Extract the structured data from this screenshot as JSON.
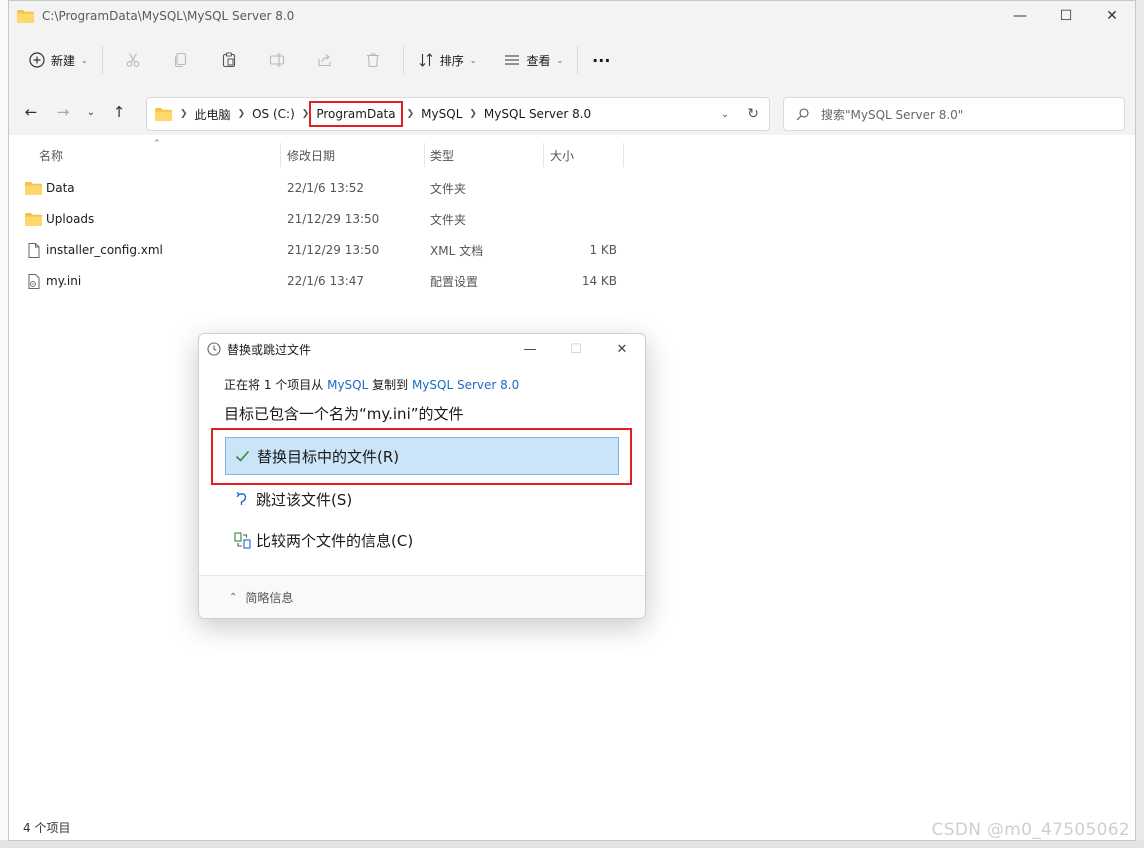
{
  "window": {
    "title": "C:\\ProgramData\\MySQL\\MySQL Server 8.0"
  },
  "toolbar": {
    "new_label": "新建",
    "sort_label": "排序",
    "view_label": "查看",
    "more_label": "···"
  },
  "address": {
    "crumbs": [
      "此电脑",
      "OS (C:)",
      "ProgramData",
      "MySQL",
      "MySQL Server 8.0"
    ]
  },
  "search": {
    "placeholder": "搜索\"MySQL Server 8.0\""
  },
  "columns": {
    "name": "名称",
    "date": "修改日期",
    "type": "类型",
    "size": "大小"
  },
  "files": [
    {
      "name": "Data",
      "date": "22/1/6 13:52",
      "type": "文件夹",
      "size": "",
      "icon": "folder-icon"
    },
    {
      "name": "Uploads",
      "date": "21/12/29 13:50",
      "type": "文件夹",
      "size": "",
      "icon": "folder-icon"
    },
    {
      "name": "installer_config.xml",
      "date": "21/12/29 13:50",
      "type": "XML 文档",
      "size": "1 KB",
      "icon": "document-icon"
    },
    {
      "name": "my.ini",
      "date": "22/1/6 13:47",
      "type": "配置设置",
      "size": "14 KB",
      "icon": "settings-file-icon"
    }
  ],
  "status": {
    "item_count": "4 个项目"
  },
  "dialog": {
    "title": "替换或跳过文件",
    "info_prefix": "正在将 1 个项目从 ",
    "info_source": "MySQL",
    "info_middle": " 复制到 ",
    "info_dest": "MySQL Server 8.0",
    "heading": "目标已包含一个名为“my.ini”的文件",
    "option_replace": "替换目标中的文件(R)",
    "option_skip": "跳过该文件(S)",
    "option_compare": "比较两个文件的信息(C)",
    "footer": "简略信息"
  },
  "watermark": "CSDN @m0_47505062",
  "colors": {
    "accent": "#1b6ac9",
    "selected_bg": "#cce4f7",
    "highlight_red": "#e02020",
    "folder": "#f4c24a"
  }
}
